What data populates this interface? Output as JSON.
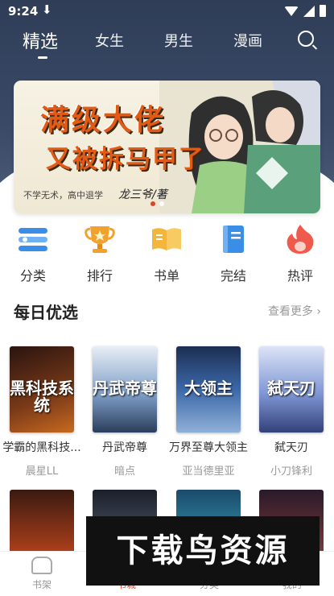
{
  "status_bar": {
    "time": "9:24",
    "download_glyph": "⬇"
  },
  "nav": {
    "tabs": [
      "精选",
      "女生",
      "男生",
      "漫画"
    ],
    "active_index": 0
  },
  "banner": {
    "title_line1": "满级大佬",
    "title_line2": "又被拆马甲了",
    "subtitle": "不学无术，高中退学",
    "author": "龙三爷/著"
  },
  "categories": [
    {
      "label": "分类",
      "icon": "list-icon",
      "color": "#3a8ee6"
    },
    {
      "label": "排行",
      "icon": "trophy-icon",
      "color": "#f2a12c"
    },
    {
      "label": "书单",
      "icon": "open-book-icon",
      "color": "#f3b53b"
    },
    {
      "label": "完结",
      "icon": "closed-book-icon",
      "color": "#3a8ee6"
    },
    {
      "label": "热评",
      "icon": "flame-icon",
      "color": "#ef5a4c"
    }
  ],
  "section": {
    "title": "每日优选",
    "more": "查看更多"
  },
  "books": [
    {
      "title": "学霸的黑科技...",
      "author": "晨星LL",
      "cover_text": "黑科技系统",
      "cover_color": "#6b2a1a"
    },
    {
      "title": "丹武帝尊",
      "author": "暗点",
      "cover_text": "丹武帝尊",
      "cover_color": "#3c5c86"
    },
    {
      "title": "万界至尊大领主",
      "author": "亚当德里亚",
      "cover_text": "大领主",
      "cover_color": "#2b4a7a"
    },
    {
      "title": "弑天刃",
      "author": "小刀锋利",
      "cover_text": "弑天刃",
      "cover_color": "#6a7fc0"
    }
  ],
  "bottom_tabs": [
    {
      "label": "书架",
      "active": false
    },
    {
      "label": "书城",
      "active": true
    },
    {
      "label": "分类",
      "active": false
    },
    {
      "label": "我的",
      "active": false
    }
  ],
  "watermark": "下载鸟资源"
}
